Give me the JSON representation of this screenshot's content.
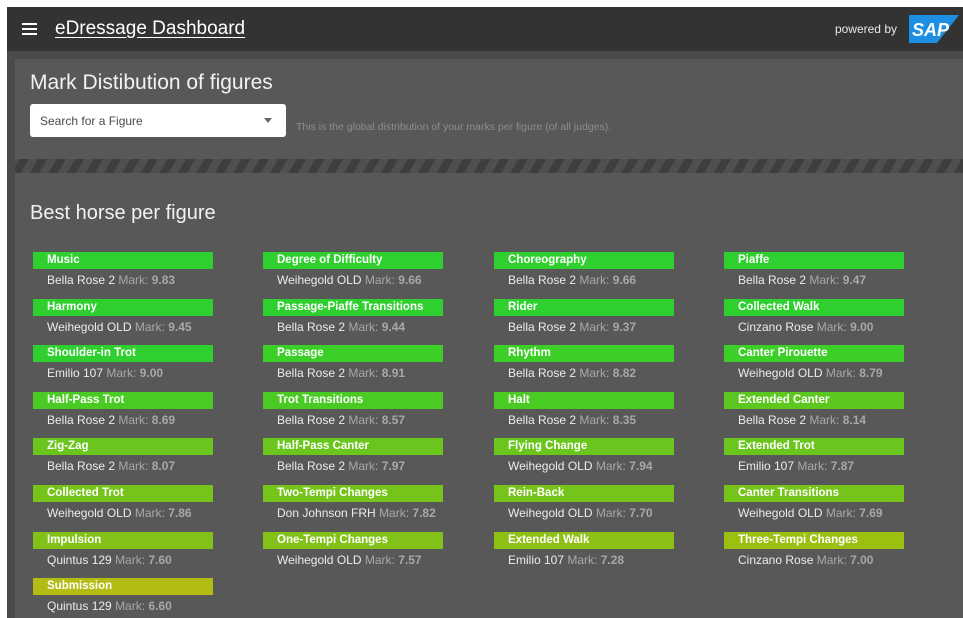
{
  "header": {
    "title": "eDressage Dashboard",
    "powered_by": "powered by",
    "logo_text": "SAP"
  },
  "distribution_card": {
    "title": "Mark Distibution of figures",
    "search_placeholder": "Search for a Figure",
    "hint": "This is the global distribution of your marks per figure (of all judges)."
  },
  "best_card": {
    "title": "Best horse per figure",
    "mark_label": "Mark:",
    "figures": [
      {
        "figure": "Music",
        "horse": "Bella Rose 2",
        "mark": "9.83",
        "color": "#2ecf2e"
      },
      {
        "figure": "Degree of Difficulty",
        "horse": "Weihegold OLD",
        "mark": "9.66",
        "color": "#2ecf2e"
      },
      {
        "figure": "Choreography",
        "horse": "Bella Rose 2",
        "mark": "9.66",
        "color": "#2ecf2e"
      },
      {
        "figure": "Piaffe",
        "horse": "Bella Rose 2",
        "mark": "9.47",
        "color": "#2ecf2e"
      },
      {
        "figure": "Harmony",
        "horse": "Weihegold OLD",
        "mark": "9.45",
        "color": "#2ecf2e"
      },
      {
        "figure": "Passage-Piaffe Transitions",
        "horse": "Bella Rose 2",
        "mark": "9.44",
        "color": "#2ecf2e"
      },
      {
        "figure": "Rider",
        "horse": "Bella Rose 2",
        "mark": "9.37",
        "color": "#2ecf2e"
      },
      {
        "figure": "Collected Walk",
        "horse": "Cinzano Rose",
        "mark": "9.00",
        "color": "#2ecf2e"
      },
      {
        "figure": "Shoulder-in Trot",
        "horse": "Emilio 107",
        "mark": "9.00",
        "color": "#2ecf2e"
      },
      {
        "figure": "Passage",
        "horse": "Bella Rose 2",
        "mark": "8.91",
        "color": "#3ccf28"
      },
      {
        "figure": "Rhythm",
        "horse": "Bella Rose 2",
        "mark": "8.82",
        "color": "#3ccf28"
      },
      {
        "figure": "Canter Pirouette",
        "horse": "Weihegold OLD",
        "mark": "8.79",
        "color": "#3ccf28"
      },
      {
        "figure": "Half-Pass Trot",
        "horse": "Bella Rose 2",
        "mark": "8.69",
        "color": "#4acb24"
      },
      {
        "figure": "Trot Transitions",
        "horse": "Bella Rose 2",
        "mark": "8.57",
        "color": "#4acb24"
      },
      {
        "figure": "Halt",
        "horse": "Bella Rose 2",
        "mark": "8.35",
        "color": "#4acb24"
      },
      {
        "figure": "Extended Canter",
        "horse": "Bella Rose 2",
        "mark": "8.14",
        "color": "#5cc81f"
      },
      {
        "figure": "Zig-Zag",
        "horse": "Bella Rose 2",
        "mark": "8.07",
        "color": "#6ac61c"
      },
      {
        "figure": "Half-Pass Canter",
        "horse": "Bella Rose 2",
        "mark": "7.97",
        "color": "#6ac61c"
      },
      {
        "figure": "Flying Change",
        "horse": "Weihegold OLD",
        "mark": "7.94",
        "color": "#6ac61c"
      },
      {
        "figure": "Extended Trot",
        "horse": "Emilio 107",
        "mark": "7.87",
        "color": "#6ac61c"
      },
      {
        "figure": "Collected Trot",
        "horse": "Weihegold OLD",
        "mark": "7.86",
        "color": "#76c41a"
      },
      {
        "figure": "Two-Tempi Changes",
        "horse": "Don Johnson FRH",
        "mark": "7.82",
        "color": "#76c41a"
      },
      {
        "figure": "Rein-Back",
        "horse": "Weihegold OLD",
        "mark": "7.70",
        "color": "#76c41a"
      },
      {
        "figure": "Canter Transitions",
        "horse": "Weihegold OLD",
        "mark": "7.69",
        "color": "#76c41a"
      },
      {
        "figure": "Impulsion",
        "horse": "Quintus 129",
        "mark": "7.60",
        "color": "#82c218"
      },
      {
        "figure": "One-Tempi Changes",
        "horse": "Weihegold OLD",
        "mark": "7.57",
        "color": "#82c218"
      },
      {
        "figure": "Extended Walk",
        "horse": "Emilio 107",
        "mark": "7.28",
        "color": "#8ec115"
      },
      {
        "figure": "Three-Tempi Changes",
        "horse": "Cinzano Rose",
        "mark": "7.00",
        "color": "#9cc010"
      },
      {
        "figure": "Submission",
        "horse": "Quintus 129",
        "mark": "6.60",
        "color": "#b2bc12"
      }
    ]
  }
}
